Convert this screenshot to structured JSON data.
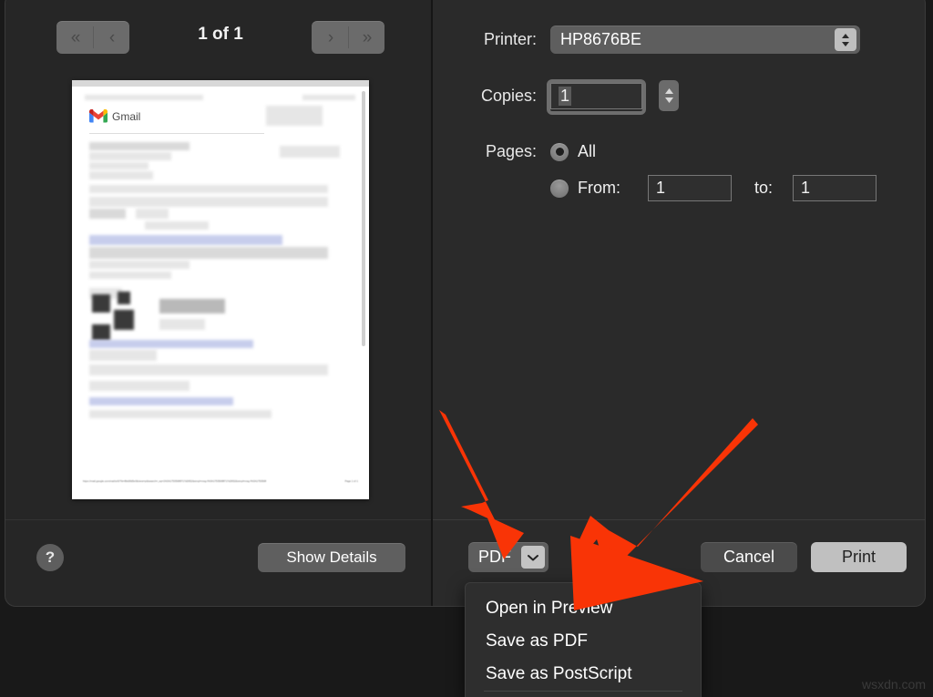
{
  "dialog": {
    "preview": {
      "nav_first_icon": "first-page-icon",
      "nav_prev_icon": "previous-page-icon",
      "nav_next_icon": "next-page-icon",
      "nav_last_icon": "last-page-icon",
      "nav_first_glyph": "«",
      "nav_prev_glyph": "‹",
      "nav_next_glyph": "›",
      "nav_last_glyph": "»",
      "page_count": "1 of 1",
      "document": {
        "brand": "Gmail",
        "footer_url": "https://mail.google.com/mail/u/0/?ik=8bd9fd5e0&view=pt&search=_sq=1%3A17535088717d2652&simpl=msg-f%3A17535088717d2652&simpl=msg-f%3A1753508",
        "footer_page": "Page 1 of 1"
      }
    },
    "left_footer": {
      "help_label": "?",
      "show_details_label": "Show Details"
    },
    "form": {
      "printer_label": "Printer:",
      "printer_value": "HP8676BE",
      "copies_label": "Copies:",
      "copies_value": "1",
      "pages_label": "Pages:",
      "pages_all_label": "All",
      "pages_from_label": "From:",
      "pages_from_value": "1",
      "pages_to_label": "to:",
      "pages_to_value": "1",
      "pages_selected": "all"
    },
    "bottom_bar": {
      "pdf_label": "PDF",
      "pdf_chevron_glyph": "⌄",
      "cancel_label": "Cancel",
      "print_label": "Print"
    },
    "pdf_menu": {
      "items": [
        {
          "label": "Open in Preview"
        },
        {
          "label": "Save as PDF"
        },
        {
          "label": "Save as PostScript"
        }
      ]
    }
  },
  "annotations": {
    "arrow_color": "#F93406",
    "arrow_1_target": "pdf-button",
    "arrow_2_target": "save-as-pdf-menu-item"
  },
  "watermark": "wsxdn.com"
}
